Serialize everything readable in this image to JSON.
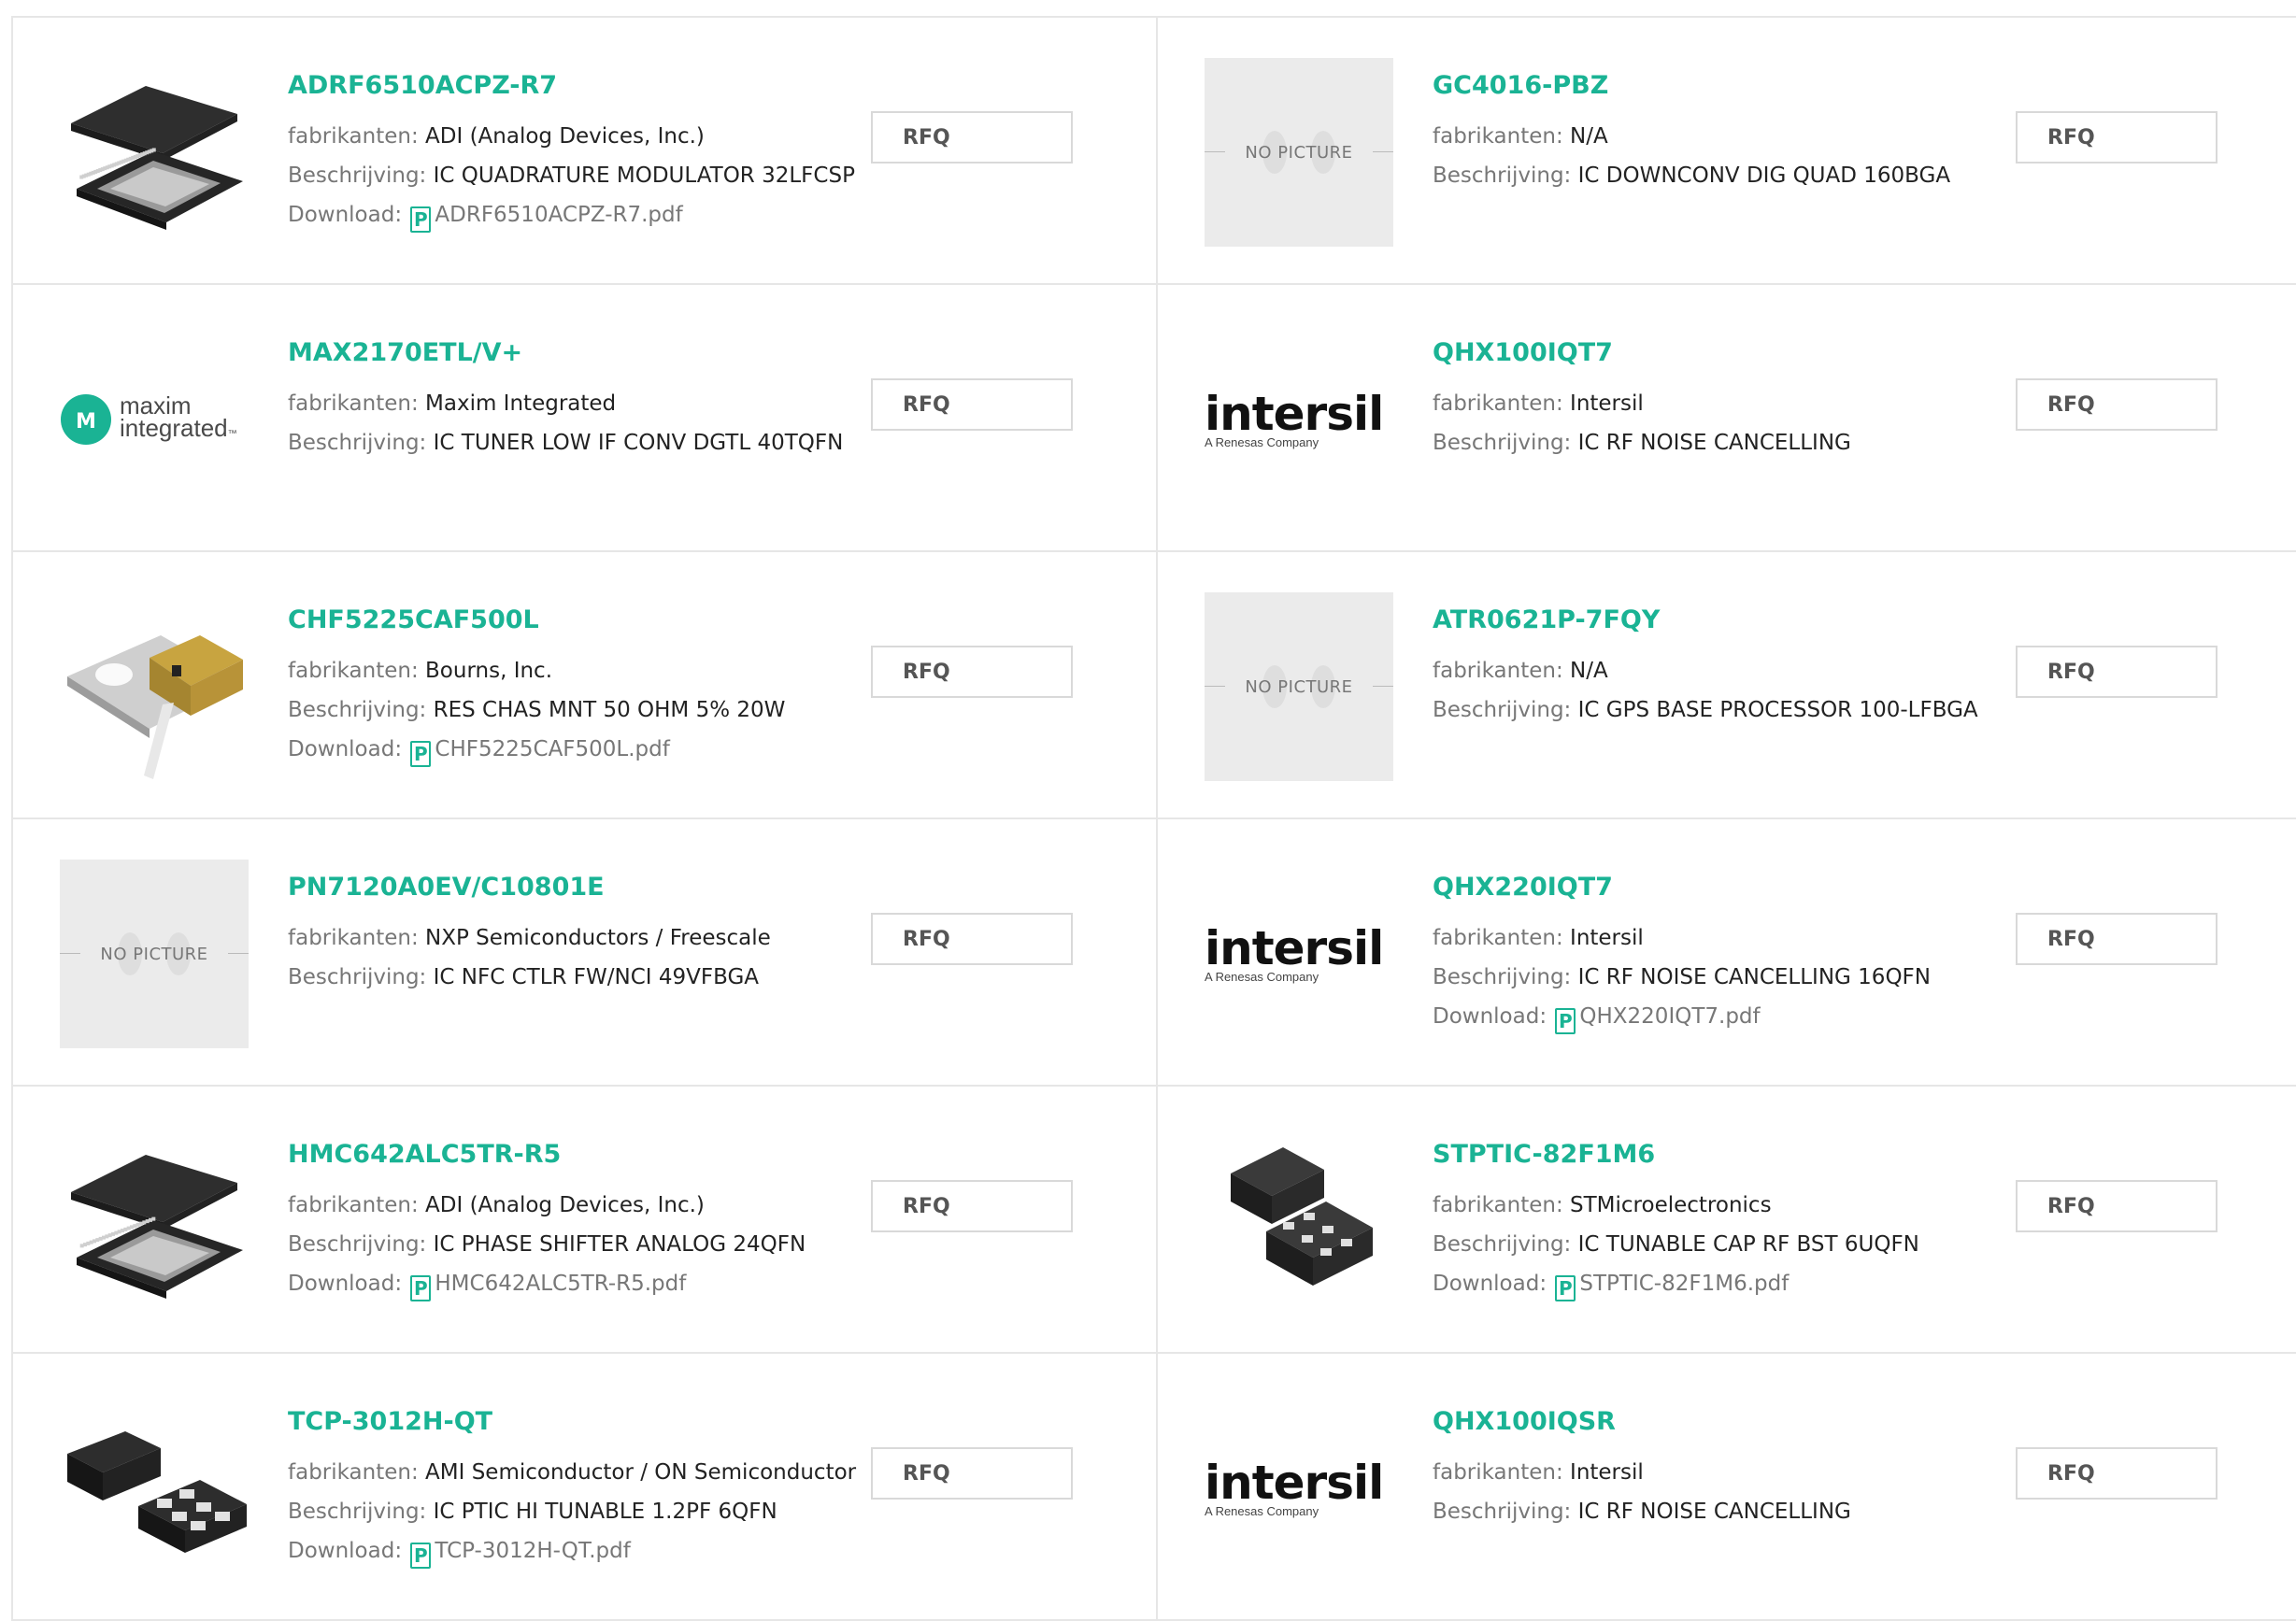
{
  "labels": {
    "manufacturer": "fabrikanten:",
    "description": "Beschrijving:",
    "download": "Download:",
    "rfq": "RFQ",
    "no_picture": "NO PICTURE",
    "pdf_glyph": "P"
  },
  "colors": {
    "accent": "#1ab394",
    "border": "#e6e6e6"
  },
  "products": [
    {
      "part": "ADRF6510ACPZ-R7",
      "manufacturer": "ADI (Analog Devices, Inc.)",
      "description": "IC QUADRATURE MODULATOR 32LFCSP",
      "download": "ADRF6510ACPZ-R7.pdf",
      "image": "qfn-package-32"
    },
    {
      "part": "GC4016-PBZ",
      "manufacturer": "N/A",
      "description": "IC DOWNCONV DIG QUAD 160BGA",
      "download": "",
      "image": "no-picture"
    },
    {
      "part": "MAX2170ETL/V+",
      "manufacturer": "Maxim Integrated",
      "description": "IC TUNER LOW IF CONV DGTL 40TQFN",
      "download": "",
      "image": "maxim-logo",
      "logo_text": [
        "maxim",
        "integrated"
      ]
    },
    {
      "part": "QHX100IQT7",
      "manufacturer": "Intersil",
      "description": "IC RF NOISE CANCELLING",
      "download": "",
      "image": "intersil-logo",
      "logo_text": [
        "intersil",
        "A Renesas Company"
      ]
    },
    {
      "part": "CHF5225CAF500L",
      "manufacturer": "Bourns, Inc.",
      "description": "RES CHAS MNT 50 OHM 5% 20W",
      "download": "CHF5225CAF500L.pdf",
      "image": "chassis-resistor"
    },
    {
      "part": "ATR0621P-7FQY",
      "manufacturer": "N/A",
      "description": "IC GPS BASE PROCESSOR 100-LFBGA",
      "download": "",
      "image": "no-picture"
    },
    {
      "part": "PN7120A0EV/C10801E",
      "manufacturer": "NXP Semiconductors / Freescale",
      "description": "IC NFC CTLR FW/NCI 49VFBGA",
      "download": "",
      "image": "no-picture"
    },
    {
      "part": "QHX220IQT7",
      "manufacturer": "Intersil",
      "description": "IC RF NOISE CANCELLING 16QFN",
      "download": "QHX220IQT7.pdf",
      "image": "intersil-logo",
      "logo_text": [
        "intersil",
        "A Renesas Company"
      ]
    },
    {
      "part": "HMC642ALC5TR-R5",
      "manufacturer": "ADI (Analog Devices, Inc.)",
      "description": "IC PHASE SHIFTER ANALOG 24QFN",
      "download": "HMC642ALC5TR-R5.pdf",
      "image": "qfn-package-24"
    },
    {
      "part": "STPTIC-82F1M6",
      "manufacturer": "STMicroelectronics",
      "description": "IC TUNABLE CAP RF BST 6UQFN",
      "download": "STPTIC-82F1M6.pdf",
      "image": "uqfn-package"
    },
    {
      "part": "TCP-3012H-QT",
      "manufacturer": "AMI Semiconductor / ON Semiconductor",
      "description": "IC PTIC HI TUNABLE 1.2PF 6QFN",
      "download": "TCP-3012H-QT.pdf",
      "image": "qfn-6-package"
    },
    {
      "part": "QHX100IQSR",
      "manufacturer": "Intersil",
      "description": "IC RF NOISE CANCELLING",
      "download": "",
      "image": "intersil-logo",
      "logo_text": [
        "intersil",
        "A Renesas Company"
      ]
    }
  ]
}
